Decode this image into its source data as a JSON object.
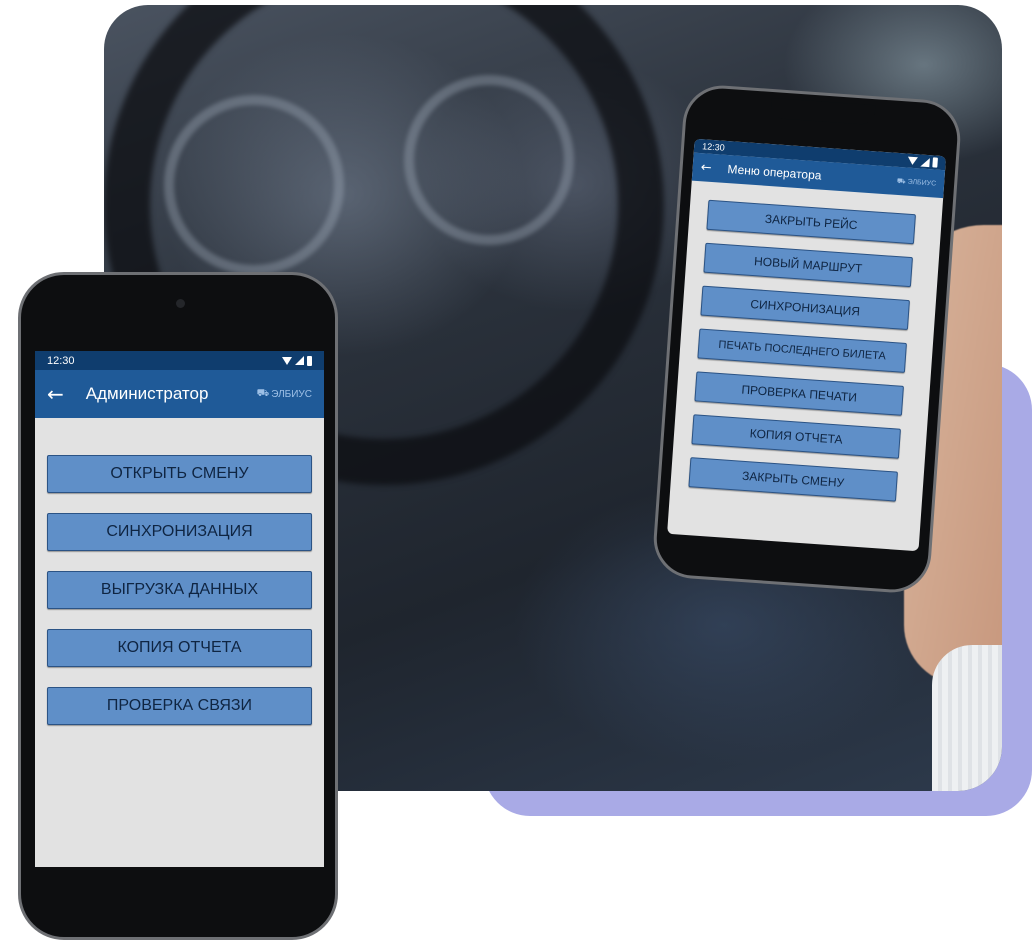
{
  "colors": {
    "status_bar": "#0f3d6e",
    "app_bar": "#1f5a98",
    "button_fill": "#5f8fc8",
    "button_border": "#2b5385",
    "screen_bg": "#e2e2e2",
    "accent_card": "#a9aae6"
  },
  "admin_phone": {
    "status": {
      "time": "12:30",
      "icons": [
        "wifi-icon",
        "signal-icon",
        "battery-icon"
      ]
    },
    "appbar": {
      "back_icon": "back-arrow-icon",
      "title": "Администратор",
      "brand": "ЭЛБИУС"
    },
    "buttons": [
      {
        "label": "ОТКРЫТЬ СМЕНУ"
      },
      {
        "label": "СИНХРОНИЗАЦИЯ"
      },
      {
        "label": "ВЫГРУЗКА ДАННЫХ"
      },
      {
        "label": "КОПИЯ ОТЧЕТА"
      },
      {
        "label": "ПРОВЕРКА СВЯЗИ"
      }
    ]
  },
  "operator_phone": {
    "status": {
      "time": "12:30",
      "icons": [
        "wifi-icon",
        "signal-icon",
        "battery-icon"
      ]
    },
    "appbar": {
      "back_icon": "back-arrow-icon",
      "title": "Меню оператора",
      "brand": "ЭЛБИУС"
    },
    "buttons": [
      {
        "label": "ЗАКРЫТЬ РЕЙС"
      },
      {
        "label": "НОВЫЙ МАРШРУТ"
      },
      {
        "label": "СИНХРОНИЗАЦИЯ"
      },
      {
        "label": "ПЕЧАТЬ ПОСЛЕДНЕГО БИЛЕТА"
      },
      {
        "label": "ПРОВЕРКА ПЕЧАТИ"
      },
      {
        "label": "КОПИЯ ОТЧЕТА"
      },
      {
        "label": "ЗАКРЫТЬ СМЕНУ"
      }
    ]
  }
}
